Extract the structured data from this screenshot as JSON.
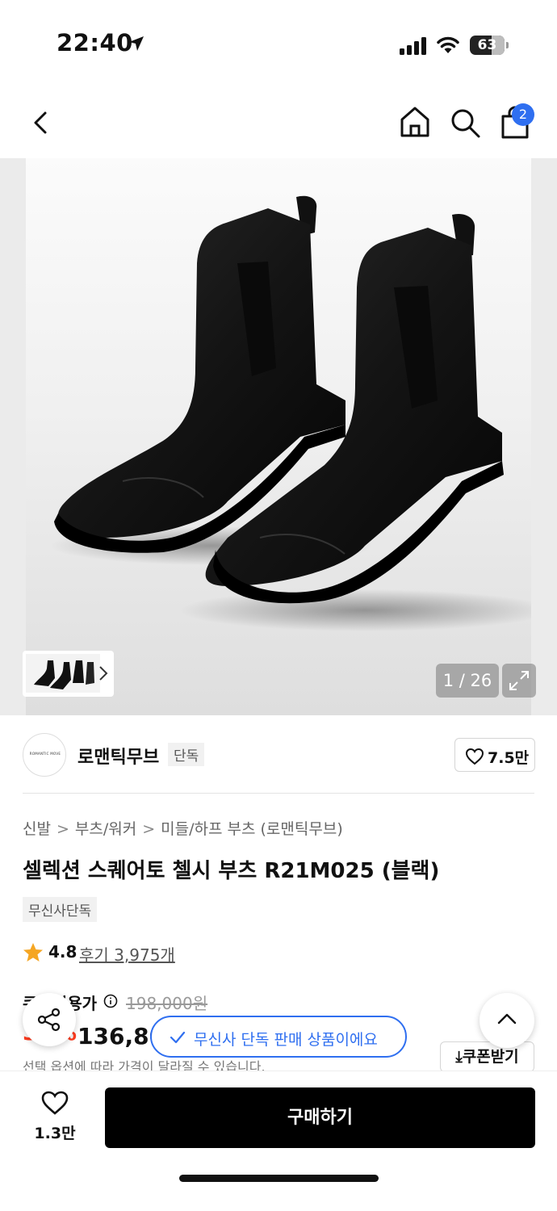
{
  "status_bar": {
    "time": "22:40",
    "battery": 63
  },
  "nav": {
    "cart_count": "2"
  },
  "gallery": {
    "counter": "1 / 26"
  },
  "brand": {
    "logo_text": "ROMANTIC MOVE",
    "name": "로맨틱무브",
    "tag": "단독",
    "likes": "7.5만"
  },
  "product": {
    "breadcrumb": [
      "신발",
      "부츠/워커",
      "미들/하프 부츠 (로맨틱무브)"
    ],
    "title": "셀렉션 스퀘어토 첼시 부츠 R21M025 (블랙)",
    "exclusive_tag": "무신사단독",
    "rating": "4.8",
    "review_text": "후기 3,975개"
  },
  "price": {
    "label": "쿠폰적용가",
    "original": "198,000원",
    "discount": "31%",
    "sale": "136,800원",
    "note": "선택 옵션에 따라 가격이 달라질 수 있습니다.",
    "coupon_button": "쿠폰받기"
  },
  "toast": {
    "message": "무신사 단독 판매 상품이에요"
  },
  "bottom": {
    "wish_count": "1.3만",
    "buy_label": "구매하기"
  },
  "colors": {
    "accent": "#2f6ff0",
    "discount": "#ff3b1f",
    "star": "#f5a623"
  }
}
